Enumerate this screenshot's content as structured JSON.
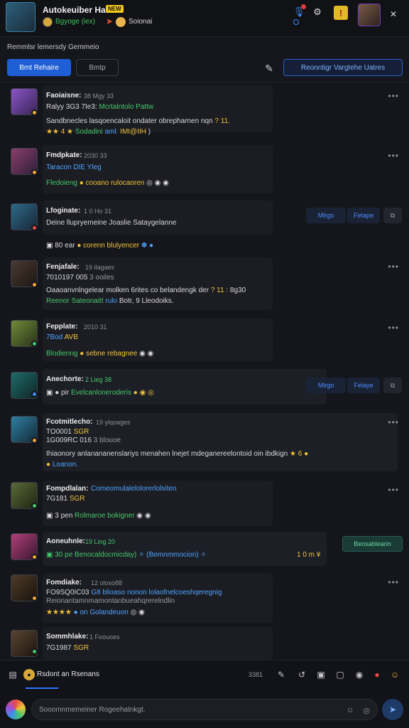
{
  "header": {
    "title": "Autokeuiber Ha:",
    "badge": "NEW",
    "subtitle": "Bgyoge (iex)",
    "subtitle2": "Soionai",
    "close_glyph": "✕"
  },
  "channel": {
    "title": "Remmlsr lemersdy Gemmeio",
    "primary_label": "Bmt Rehaire",
    "secondary_label": "Bmtp",
    "outline_label": "Reonntigr Vargtehe Uatres"
  },
  "messages": [
    {
      "name": "Faoiaisne:",
      "time": "38 Mgy 33",
      "lines": [
        {
          "segments": [
            {
              "text": "Ralyy 3G3 7Ie3:",
              "cls": "c-white"
            },
            {
              "text": " Mcrtalntolo Pattw",
              "cls": "c-green"
            }
          ]
        },
        {
          "segments": [
            {
              "text": "Sandbnecles lasqoencaloit ondater obrepharnen nqn ",
              "cls": "c-white"
            },
            {
              "text": "? 11.",
              "cls": "c-yellow"
            }
          ]
        },
        {
          "segments": [
            {
              "text": "★★ 4 ★",
              "cls": "c-yellow"
            },
            {
              "text": " Sodadini ",
              "cls": "c-green"
            },
            {
              "text": "aml. ",
              "cls": "c-blue"
            },
            {
              "text": "IMI@IIH",
              "cls": "c-yellow"
            },
            {
              "text": " )",
              "cls": "c-white"
            }
          ]
        }
      ]
    },
    {
      "name": "Fmdpkate:",
      "time": "2030 33",
      "lines": [
        {
          "segments": [
            {
              "text": "Taracon DIE Yleg",
              "cls": "c-blue"
            }
          ]
        },
        {
          "segments": [
            {
              "text": "Fledoieng",
              "cls": "c-green"
            },
            {
              "text": " ● cooano rulocaoren",
              "cls": "c-yellow"
            },
            {
              "text": " ◎ ◉ ◉",
              "cls": "c-white"
            }
          ]
        }
      ]
    },
    {
      "name": "Lfoginate:",
      "time": "1 0 Ho 31",
      "lines": [
        {
          "segments": [
            {
              "text": "Deine llupryemeine Joaslie Sataygelanne",
              "cls": "c-white"
            }
          ]
        },
        {
          "segments": [
            {
              "text": "▣ 80 ear ",
              "cls": "c-white"
            },
            {
              "text": "● corenn blulyencer",
              "cls": "c-yellow"
            },
            {
              "text": " ✽ ●",
              "cls": "c-blue"
            }
          ]
        }
      ],
      "pills": [
        "Mlrgo",
        "Fetape"
      ]
    },
    {
      "name": "Fenjafale:",
      "time": "19 ilagaes",
      "lines": [
        {
          "segments": [
            {
              "text": "7010197 005",
              "cls": "c-white"
            },
            {
              "text": " 3 ooiles",
              "cls": "c-gray"
            }
          ]
        },
        {
          "segments": [
            {
              "text": "Oaaoanvnlngelear molken 6rites co belandengk der ",
              "cls": "c-white"
            },
            {
              "text": "? 11 :",
              "cls": "c-yellow"
            },
            {
              "text": " 8g30",
              "cls": "c-white"
            }
          ]
        },
        {
          "segments": [
            {
              "text": "Reenor Sateonaitt ",
              "cls": "c-green"
            },
            {
              "text": "rulo",
              "cls": "c-blue"
            },
            {
              "text": " Botr, 9 Lleodoiks.",
              "cls": "c-white"
            }
          ]
        }
      ]
    },
    {
      "name": "Fepplate:",
      "time": "2010 31",
      "lines": [
        {
          "segments": [
            {
              "text": "7Bod ",
              "cls": "c-blue"
            },
            {
              "text": "AVB",
              "cls": "c-yellow"
            }
          ]
        },
        {
          "segments": [
            {
              "text": "Blodienng",
              "cls": "c-green"
            },
            {
              "text": " ● sebne rebagnee",
              "cls": "c-yellow"
            },
            {
              "text": " ◉ ◉",
              "cls": "c-white"
            }
          ]
        }
      ]
    },
    {
      "name": "Anechorte:",
      "time": "2 Lieg 38",
      "lines": [
        {
          "segments": [
            {
              "text": "▣ ● pir ",
              "cls": "c-white"
            },
            {
              "text": "Evelcanloneroderis",
              "cls": "c-green"
            },
            {
              "text": " ● ◉ ◎",
              "cls": "c-yellow"
            }
          ]
        }
      ],
      "pills": [
        "Mlrgo",
        "Felaye"
      ]
    },
    {
      "name": "Fcotmitlecho:",
      "time": "19 ylqoages",
      "lines": [
        {
          "segments": [
            {
              "text": "TO0001 ",
              "cls": "c-white"
            },
            {
              "text": "SGR",
              "cls": "c-yellow"
            }
          ]
        },
        {
          "segments": [
            {
              "text": "1G009RC 016 ",
              "cls": "c-white"
            },
            {
              "text": "3 blouoe",
              "cls": "c-gray"
            }
          ]
        },
        {
          "segments": [
            {
              "text": "Ihiaonory anlanananenslariys menahen lnejet mdeganereelontoid oin ibdkign ",
              "cls": "c-white"
            },
            {
              "text": "★ 6 ●",
              "cls": "c-yellow"
            }
          ]
        },
        {
          "segments": [
            {
              "text": "● ",
              "cls": "c-yellow"
            },
            {
              "text": "Loanon.",
              "cls": "c-blue"
            }
          ]
        }
      ]
    },
    {
      "name": "Fompdlalan:",
      "time": "Comeomulalelolorerlolsiten",
      "lines": [
        {
          "segments": [
            {
              "text": "7G181 ",
              "cls": "c-white"
            },
            {
              "text": "SGR",
              "cls": "c-yellow"
            }
          ]
        },
        {
          "segments": [
            {
              "text": "▣ 3 pen ",
              "cls": "c-white"
            },
            {
              "text": "Rolmaroe bokigner",
              "cls": "c-green"
            },
            {
              "text": " ◉ ◉",
              "cls": "c-white"
            }
          ]
        }
      ]
    },
    {
      "name": "Aoneuhnle:",
      "time": "19 Ling 20",
      "lines": [
        {
          "segments": [
            {
              "text": "▣ 30 pe ",
              "cls": "c-green"
            },
            {
              "text": "Benocaldocmicday) ",
              "cls": "c-green"
            },
            {
              "text": "✧ ",
              "cls": "c-blue"
            },
            {
              "text": "(Bemnmmocion) ✧",
              "cls": "c-blue"
            }
          ]
        }
      ],
      "side_label": "1 0 m ¥",
      "green_pill": "Beosablearin"
    },
    {
      "name": "Fomdiake:",
      "time": "12 oloso88",
      "lines": [
        {
          "segments": [
            {
              "text": "FO9SQ0IC03 ",
              "cls": "c-white"
            },
            {
              "text": "G8 blioaso nonon lolaofnelcoeshqeregnig",
              "cls": "c-blue"
            }
          ]
        },
        {
          "segments": [
            {
              "text": "Reionantamnmamontanbueahqrerelndlin",
              "cls": "c-gray"
            }
          ]
        },
        {
          "segments": [
            {
              "text": "★★★★ ",
              "cls": "c-yellow"
            },
            {
              "text": "● on Golandeuon",
              "cls": "c-blue"
            },
            {
              "text": " ◎ ◉",
              "cls": "c-white"
            }
          ]
        }
      ]
    },
    {
      "name": "Sommhlake:",
      "time": "1 Foouoes",
      "lines": [
        {
          "segments": [
            {
              "text": "7G1987 ",
              "cls": "c-white"
            },
            {
              "text": "SGR",
              "cls": "c-yellow"
            }
          ]
        }
      ]
    }
  ],
  "composer": {
    "tab_label": "Rsdont an Rsenans",
    "count": "3381",
    "placeholder": "Sooomnmemeiner Rogeehatnkgt."
  },
  "colors": {
    "accent": "#1f5fd6",
    "online": "#45c86a",
    "away": "#f0a53a",
    "busy": "#e84b4b"
  }
}
